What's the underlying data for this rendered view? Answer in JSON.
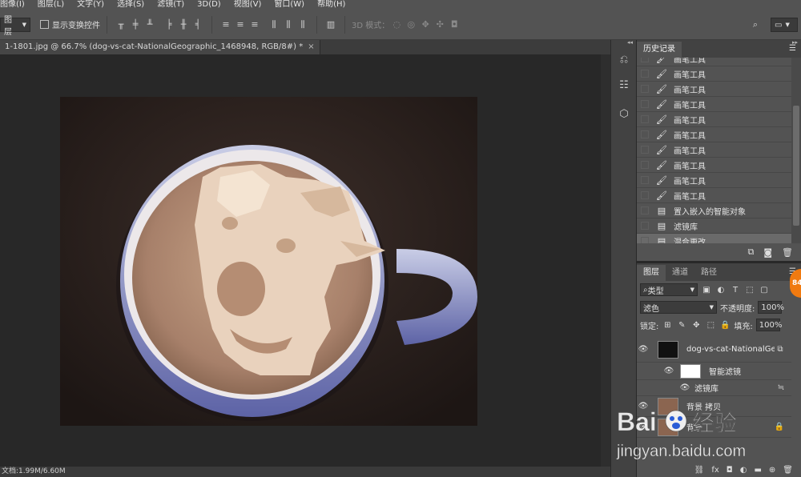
{
  "menubar": [
    "图像(I)",
    "图层(L)",
    "文字(Y)",
    "选择(S)",
    "滤镜(T)",
    "3D(D)",
    "视图(V)",
    "窗口(W)",
    "帮助(H)"
  ],
  "optbar": {
    "layer_select": "图层",
    "transform_checkbox_label": "显示变换控件",
    "mode_3d_label": "3D 模式："
  },
  "document": {
    "tab_title": "1-1801.jpg @ 66.7% (dog-vs-cat-NationalGeographic_1468948, RGB/8#) *",
    "close_glyph": "×",
    "zoom": "66.7%"
  },
  "statusbar": {
    "doc_info": "文档:1.99M/6.60M"
  },
  "history_panel": {
    "tab_label": "历史记录",
    "items": [
      {
        "icon": "brush-icon",
        "label": "画笔工具"
      },
      {
        "icon": "brush-icon",
        "label": "画笔工具"
      },
      {
        "icon": "brush-icon",
        "label": "画笔工具"
      },
      {
        "icon": "brush-icon",
        "label": "画笔工具"
      },
      {
        "icon": "brush-icon",
        "label": "画笔工具"
      },
      {
        "icon": "brush-icon",
        "label": "画笔工具"
      },
      {
        "icon": "brush-icon",
        "label": "画笔工具"
      },
      {
        "icon": "brush-icon",
        "label": "画笔工具"
      },
      {
        "icon": "brush-icon",
        "label": "画笔工具"
      },
      {
        "icon": "brush-icon",
        "label": "画笔工具"
      },
      {
        "icon": "document-icon",
        "label": "置入嵌入的智能对象"
      },
      {
        "icon": "document-icon",
        "label": "滤镜库"
      },
      {
        "icon": "document-icon",
        "label": "混合更改"
      }
    ]
  },
  "layers_panel": {
    "tabs": [
      "图层",
      "通道",
      "路径"
    ],
    "filter_kind": "类型",
    "blend_mode": "滤色",
    "opacity_label": "不透明度:",
    "opacity_value": "100%",
    "lock_label": "锁定:",
    "fill_label": "填充:",
    "fill_value": "100%",
    "layers": [
      {
        "name": "dog-vs-cat-NationalGe..."
      },
      {
        "name": "智能滤镜"
      },
      {
        "name": "滤镜库"
      },
      {
        "name": "背景 拷贝"
      },
      {
        "name": "背景"
      }
    ]
  },
  "badge": {
    "text": "84"
  },
  "watermark": {
    "brand_text": "Bai",
    "brand_cn": "经验",
    "url": "jingyan.baidu.com"
  },
  "colors": {
    "accent_orange": "#f07a10",
    "panel_bg": "#535353",
    "canvas_bg": "#282828"
  }
}
